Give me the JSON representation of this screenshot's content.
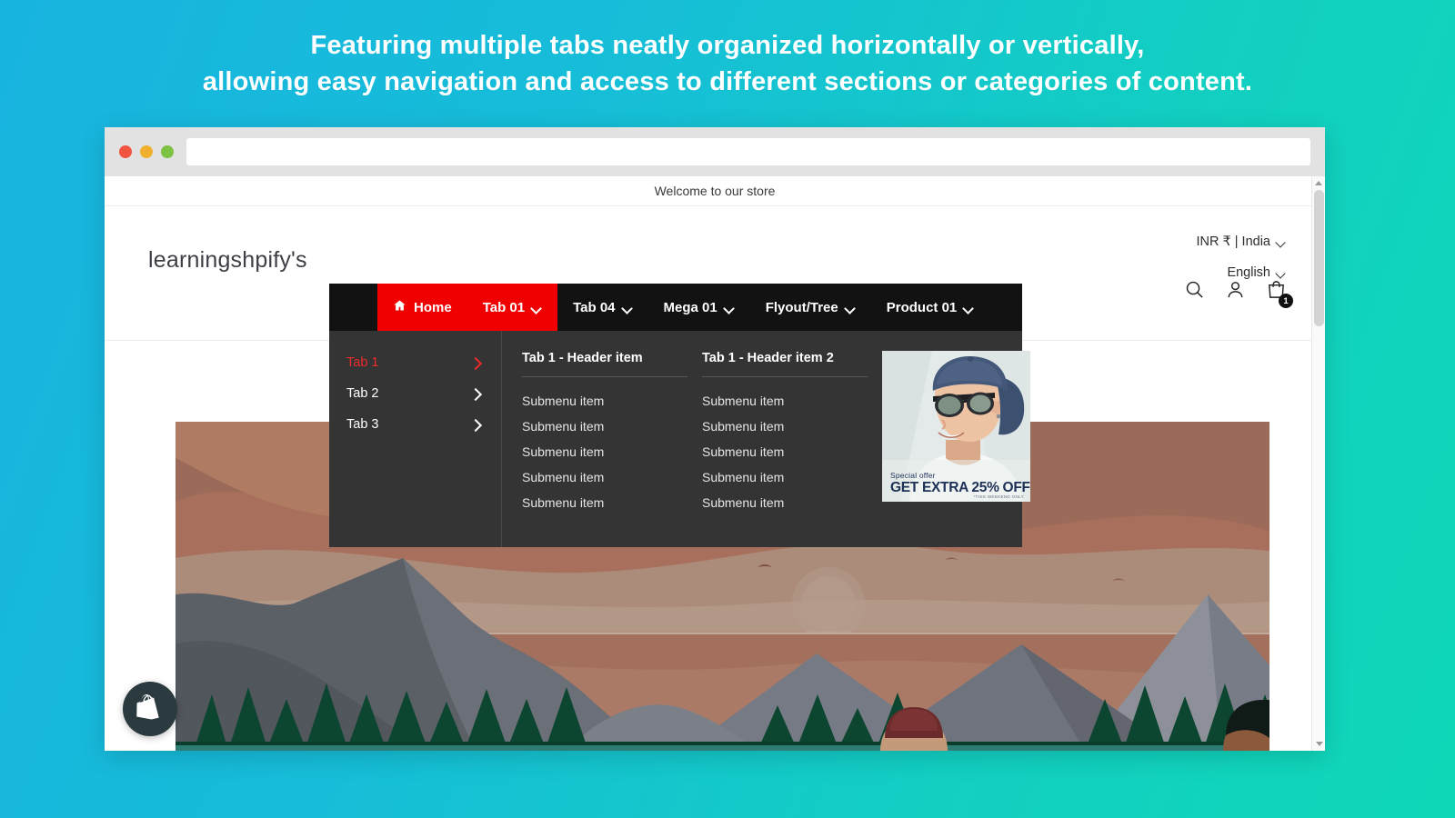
{
  "headline": {
    "line1": "Featuring multiple tabs neatly organized horizontally or vertically,",
    "line2": "allowing easy navigation and access to different sections or categories of content."
  },
  "browser": {
    "dots": [
      "close-red",
      "minimize-yellow",
      "maximize-green"
    ],
    "url_value": "",
    "url_placeholder": ""
  },
  "store": {
    "announcement": "Welcome to our store",
    "logo": "learningshpify's",
    "utils": {
      "currency": "INR ₹ | India",
      "language": "English"
    },
    "icons": {
      "search": "search-icon",
      "account": "account-icon",
      "cart": "cart-icon",
      "cart_count": "1"
    }
  },
  "nav": {
    "items": [
      {
        "label": "Home",
        "icon": "home-icon",
        "has_caret": false,
        "state": "active"
      },
      {
        "label": "Tab 01",
        "icon": "",
        "has_caret": true,
        "state": "open"
      },
      {
        "label": "Tab 04",
        "icon": "",
        "has_caret": true,
        "state": "normal"
      },
      {
        "label": "Mega 01",
        "icon": "",
        "has_caret": true,
        "state": "normal"
      },
      {
        "label": "Flyout/Tree",
        "icon": "",
        "has_caret": true,
        "state": "normal"
      },
      {
        "label": "Product 01",
        "icon": "",
        "has_caret": true,
        "state": "normal"
      }
    ]
  },
  "dropdown": {
    "tabs": [
      {
        "label": "Tab 1",
        "active": true
      },
      {
        "label": "Tab 2",
        "active": false
      },
      {
        "label": "Tab 3",
        "active": false
      }
    ],
    "columns": [
      {
        "title": "Tab 1 - Header item",
        "links": [
          "Submenu item",
          "Submenu item",
          "Submenu item",
          "Submenu item",
          "Submenu item"
        ]
      },
      {
        "title": "Tab 1 - Header item 2",
        "links": [
          "Submenu item",
          "Submenu item",
          "Submenu item",
          "Submenu item",
          "Submenu item"
        ]
      }
    ],
    "promo": {
      "subtitle": "Special offer",
      "title": "GET EXTRA 25% OFF",
      "fineprint": "*THIS WEEKEND ONLY"
    }
  },
  "colors": {
    "accent_red": "#f00000",
    "nav_bg": "#121212",
    "dropdown_bg": "#343434",
    "page_bg_start": "#18b4e0",
    "page_bg_end": "#0fd8b8"
  }
}
